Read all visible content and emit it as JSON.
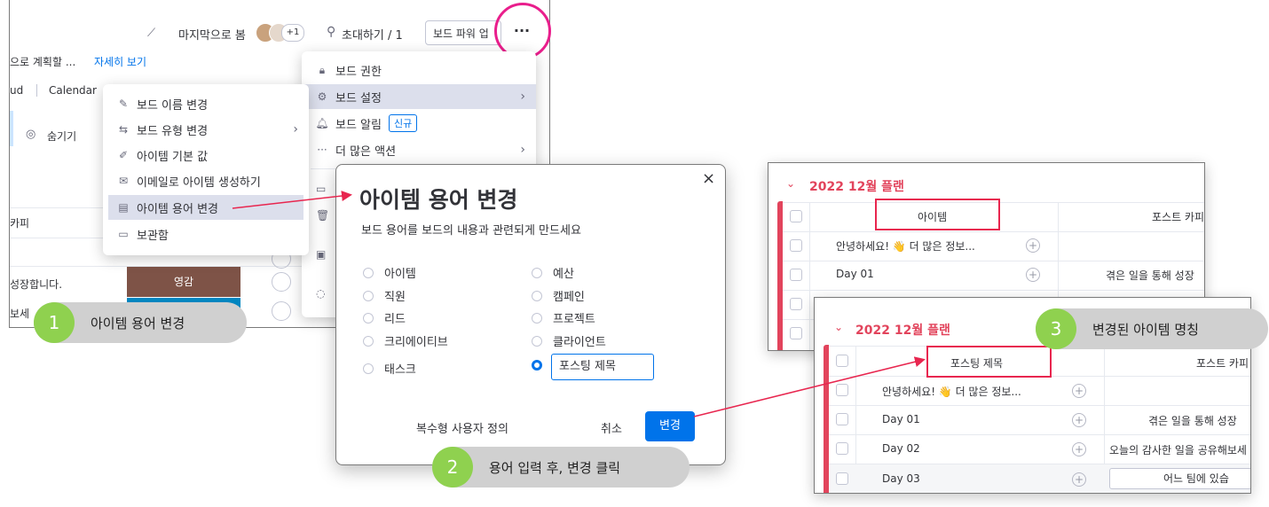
{
  "board_panel": {
    "last_seen": "마지막으로 봄",
    "avatar_count": "+1",
    "invite": "초대하기 / 1",
    "power_up": "보드 파워 업",
    "more": "···",
    "description_partial": "으로 계획할 ...",
    "see_more": "자세히 보기",
    "view_tab_1": "ud",
    "view_tab_2": "Calendar",
    "hide": "숨기기",
    "col_copy": "카피",
    "row_text_1": "성장합니다.",
    "row_text_2": "보세",
    "status_label": "영감",
    "status_color": "#7e5347"
  },
  "item_menu": {
    "items": [
      {
        "label": "보드 이름 변경",
        "icon": "pencil-icon"
      },
      {
        "label": "보드 유형 변경",
        "icon": "swap-icon",
        "chevron": true
      },
      {
        "label": "아이템 기본 값",
        "icon": "edit-icon"
      },
      {
        "label": "이메일로 아이템 생성하기",
        "icon": "mail-icon"
      },
      {
        "label": "아이템 용어 변경",
        "icon": "card-icon",
        "highlighted": true
      },
      {
        "label": "보관함",
        "icon": "archive-icon"
      }
    ]
  },
  "board_menu": {
    "items": [
      {
        "label": "보드 권한",
        "icon": "lock-icon"
      },
      {
        "label": "보드 설정",
        "icon": "settings-icon",
        "chevron": true,
        "highlighted": true
      },
      {
        "label": "보드 알림",
        "icon": "bell-icon",
        "badge": "신규"
      },
      {
        "label": "더 많은 액션",
        "icon": "dots-icon",
        "chevron": true
      }
    ]
  },
  "dialog": {
    "close": "×",
    "title": "아이템 용어 변경",
    "subtitle": "보드 용어를 보드의 내용과 관련되게 만드세요",
    "options_left": [
      "아이템",
      "직원",
      "리드",
      "크리에이티브",
      "태스크"
    ],
    "options_right": [
      "예산",
      "캠페인",
      "프로젝트",
      "클라이언트"
    ],
    "custom_value": "포스팅 제목",
    "multi_custom": "복수형 사용자 정의",
    "cancel": "취소",
    "submit": "변경"
  },
  "table_before": {
    "group_title": "2022 12월 플랜",
    "col_item": "아이템",
    "col_post": "포스트 카피",
    "rows": [
      {
        "name": "안녕하세요! 👋 더 많은 정보...",
        "post": ""
      },
      {
        "name": "Day 01",
        "post": "겪은 일을 통해 성장"
      }
    ]
  },
  "table_after": {
    "group_title": "2022 12월 플랜",
    "col_item": "포스팅 제목",
    "col_post": "포스트 카피",
    "rows": [
      {
        "name": "안녕하세요! 👋 더 많은 정보...",
        "post": ""
      },
      {
        "name": "Day 01",
        "post": "겪은 일을 통해 성장"
      },
      {
        "name": "Day 02",
        "post": "오늘의 감사한 일을 공유해보세"
      },
      {
        "name": "Day 03",
        "post": "어느 팀에 있습"
      }
    ]
  },
  "callouts": {
    "c1_num": "1",
    "c1_text": "아이템 용어 변경",
    "c2_num": "2",
    "c2_text": "용어 입력 후, 변경 클릭",
    "c3_num": "3",
    "c3_text": "변경된 아이템 명칭"
  },
  "colors": {
    "accent_blue": "#0073ea",
    "group_pink": "#e2445c",
    "highlight_ring": "#e91e8c",
    "arrow": "#e8264f"
  }
}
